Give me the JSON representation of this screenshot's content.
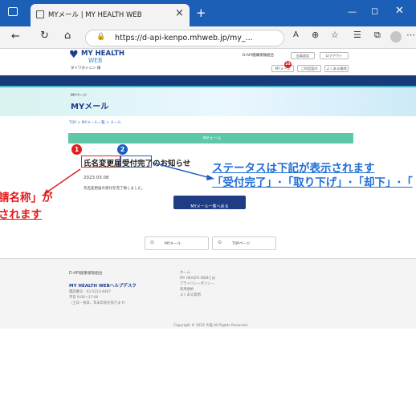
{
  "browser": {
    "tab_title": "MYメール | MY HEALTH WEB",
    "url": "https://d-api-kenpo.mhweb.jp/my_...",
    "new_tab": "+",
    "close_tab": "×"
  },
  "header": {
    "logo_line1": "MY HEALTH",
    "logo_line2": "WEB",
    "user_name": "ダイワホシニン 様",
    "org_name": "D-API健康保険組合",
    "btn_member": "会員設定",
    "btn_logout": "ログアウト",
    "btn_mymail": "MYメール",
    "btn_mymail_badge": "25",
    "btn_usage": "ご利用案内",
    "btn_faq": "よくある質問"
  },
  "hero": {
    "sub": "MYページ",
    "title": "MYメール"
  },
  "breadcrumb": "TOP > MYメール一覧 > メール",
  "mail": {
    "section_title": "MYメール",
    "subject_part1": "氏名変更届",
    "subject_part2": "受付完了",
    "subject_part3": "のお知らせ",
    "date": "2023.03.08",
    "body": "氏名変更届の受付を完了致しました。",
    "back_button": "MYメール一覧へ戻る"
  },
  "bottom_nav": {
    "mymail": "MYメール",
    "top": "TOPページ"
  },
  "footer": {
    "org": "D-API健康保険組合",
    "help_title": "MY HEALTH WEBヘルプデスク",
    "phone": "電話番号：03-5213-4467",
    "hours": "平日 9:00～17:00",
    "hours_note": "（土日・祝日、年末年始を除きます）",
    "links": [
      "ホーム",
      "MY HEALTH WEBとは",
      "プライバシーポリシー",
      "利用規約",
      "よくある質問"
    ],
    "copyright": "Copyright © 2022 大阪 All Rights Reserved."
  },
  "annotations": {
    "num1": "1",
    "num2": "2",
    "left_line1": "請名称」が",
    "left_line2": "されます",
    "right_line1": "ステータスは下記が表示されます",
    "right_line2": "「受付完了」･「取り下げ」･「却下」･「"
  },
  "colors": {
    "chrome_blue": "#1b5fb6",
    "navy": "#173a7a",
    "green": "#5ec7a8",
    "ann_red": "#e61919",
    "ann_blue": "#1f6fd6"
  }
}
